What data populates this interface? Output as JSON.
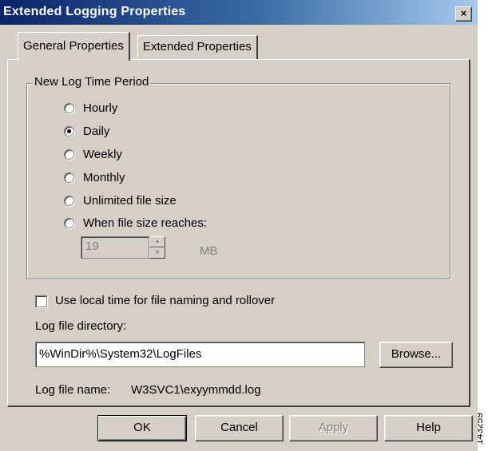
{
  "window": {
    "title": "Extended Logging Properties",
    "close_label": "×"
  },
  "tabs": [
    {
      "label": "General Properties",
      "active": true
    },
    {
      "label": "Extended Properties",
      "active": false
    }
  ],
  "log_period": {
    "legend": "New Log Time Period",
    "options": [
      {
        "label": "Hourly",
        "checked": false
      },
      {
        "label": "Daily",
        "checked": true
      },
      {
        "label": "Weekly",
        "checked": false
      },
      {
        "label": "Monthly",
        "checked": false
      },
      {
        "label": "Unlimited file size",
        "checked": false
      },
      {
        "label": "When file size reaches:",
        "checked": false
      }
    ],
    "size_value": "19",
    "size_unit": "MB"
  },
  "local_time": {
    "label": "Use local time for file naming and rollover",
    "checked": false
  },
  "directory": {
    "label": "Log file directory:",
    "value": "%WinDir%\\System32\\LogFiles",
    "browse_label": "Browse..."
  },
  "log_file": {
    "label": "Log file name:",
    "value": "W3SVC1\\exyymmdd.log"
  },
  "buttons": {
    "ok": "OK",
    "cancel": "Cancel",
    "apply": "Apply",
    "help": "Help"
  },
  "figure_number": "143259",
  "colors": {
    "dialog_face": "#d4d0c8",
    "title_start": "#0a246a",
    "title_end": "#a6caf0",
    "disabled_text": "#808080"
  }
}
